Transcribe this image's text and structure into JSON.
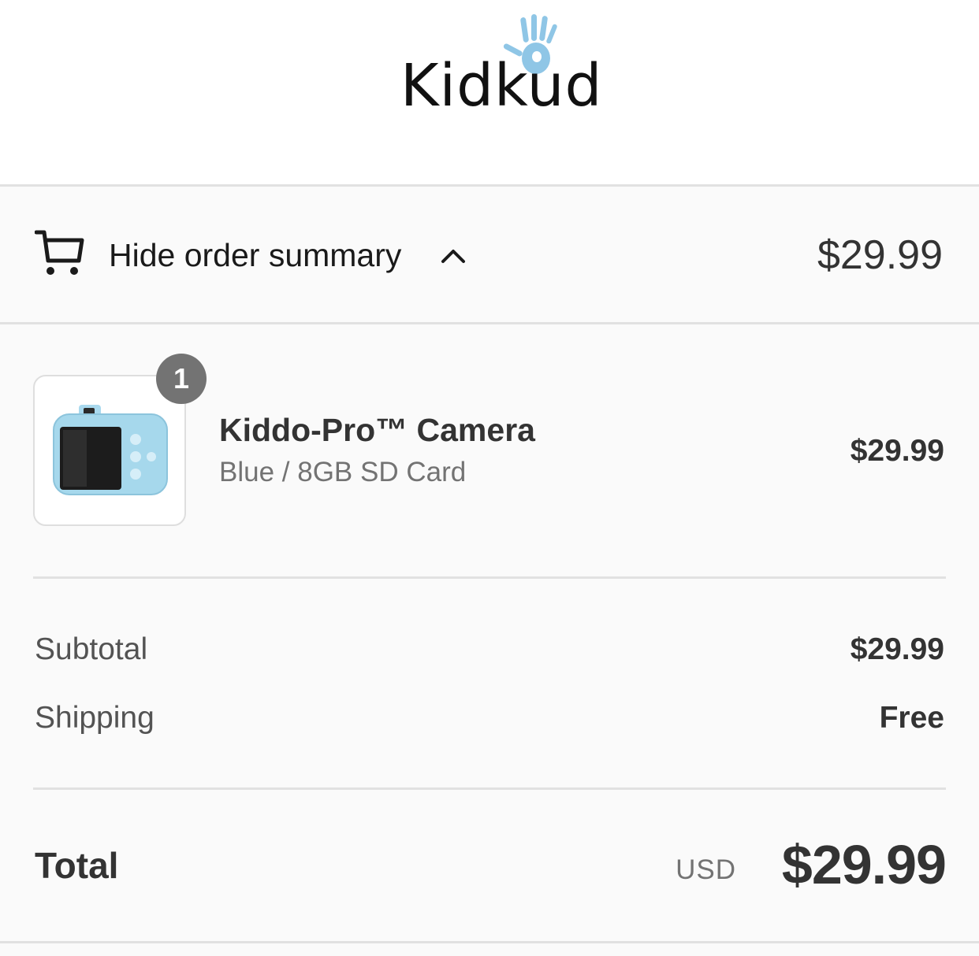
{
  "brand": {
    "name": "Kidkud",
    "accent_color": "#8fc6e6"
  },
  "summary_toggle": {
    "label": "Hide order summary",
    "icon": "cart-icon",
    "chevron_icon": "chevron-up-icon",
    "price": "$29.99"
  },
  "line_items": [
    {
      "quantity": "1",
      "name": "Kiddo-Pro™ Camera",
      "variant": "Blue / 8GB SD Card",
      "price": "$29.99",
      "image_icon": "kids-camera-image"
    }
  ],
  "totals": {
    "subtotal_label": "Subtotal",
    "subtotal_value": "$29.99",
    "shipping_label": "Shipping",
    "shipping_value": "Free",
    "total_label": "Total",
    "currency": "USD",
    "total_value": "$29.99"
  }
}
